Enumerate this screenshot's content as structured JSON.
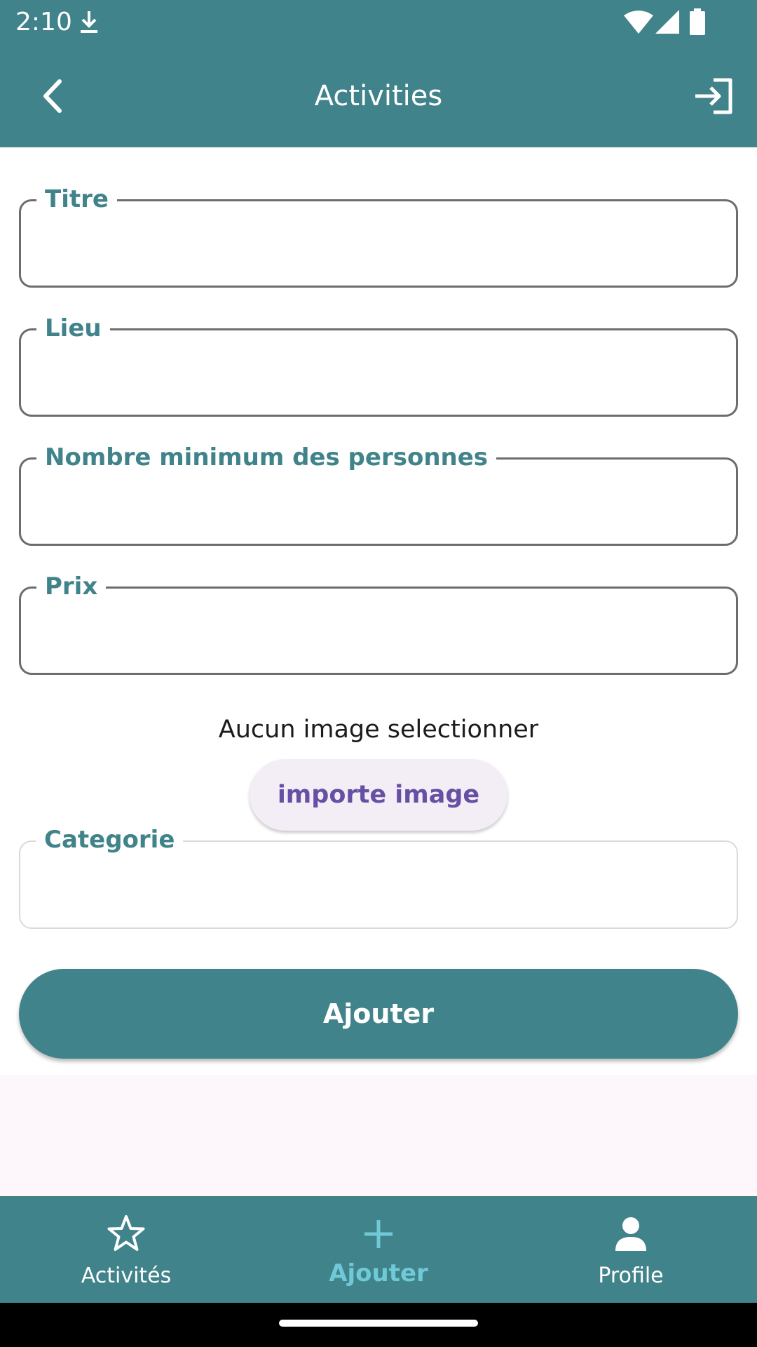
{
  "status_bar": {
    "time": "2:10",
    "icons": [
      "download-icon",
      "wifi-icon",
      "signal-icon",
      "battery-icon"
    ]
  },
  "app_bar": {
    "title": "Activities",
    "back_icon": "chevron-left-icon",
    "action_icon": "logout-icon",
    "background_color": "#40838a"
  },
  "form": {
    "fields": [
      {
        "label": "Titre",
        "value": "",
        "placeholder": ""
      },
      {
        "label": "Lieu",
        "value": "",
        "placeholder": ""
      },
      {
        "label": "Nombre minimum des personnes",
        "value": "",
        "placeholder": ""
      },
      {
        "label": "Prix",
        "value": "",
        "placeholder": ""
      }
    ],
    "image_status": "Aucun image selectionner",
    "import_button": "importe image",
    "category": {
      "label": "Categorie",
      "value": ""
    },
    "submit_button": "Ajouter"
  },
  "bottom_nav": {
    "items": [
      {
        "label": "Activités",
        "icon": "star-icon",
        "active": false
      },
      {
        "label": "Ajouter",
        "icon": "plus-icon",
        "active": true
      },
      {
        "label": "Profile",
        "icon": "person-icon",
        "active": false
      }
    ],
    "active_color": "#6fc9d6"
  },
  "colors": {
    "primary": "#40838a",
    "accent_button_text": "#6750a4"
  }
}
